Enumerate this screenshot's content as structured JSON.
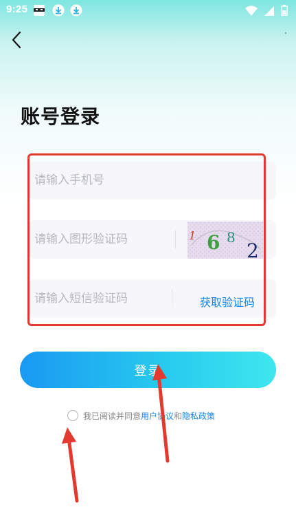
{
  "status_bar": {
    "time": "9:25",
    "left_icons": [
      "ninja-app-icon",
      "download-icon",
      "download-icon"
    ],
    "right_icons": [
      "wifi-icon",
      "cellular-signal-icon",
      "battery-icon"
    ]
  },
  "header": {
    "back_icon": "chevron-left-icon"
  },
  "page": {
    "title": "账号登录"
  },
  "form": {
    "phone": {
      "value": "",
      "placeholder": "请输入手机号"
    },
    "captcha": {
      "value": "",
      "placeholder": "请输入图形验证码",
      "image_text": "1682"
    },
    "sms": {
      "value": "",
      "placeholder": "请输入短信验证码",
      "get_code_label": "获取验证码"
    },
    "login_label": "登录"
  },
  "agreement": {
    "checked": false,
    "prefix": "我已阅读并同意",
    "user_agreement": "用户协议",
    "and": "和",
    "privacy_policy": "隐私政策"
  },
  "colors": {
    "accent": "#1a86e8",
    "button_start": "#1a99f2",
    "button_end": "#3fe6ee",
    "annotation": "#e23a2e"
  }
}
